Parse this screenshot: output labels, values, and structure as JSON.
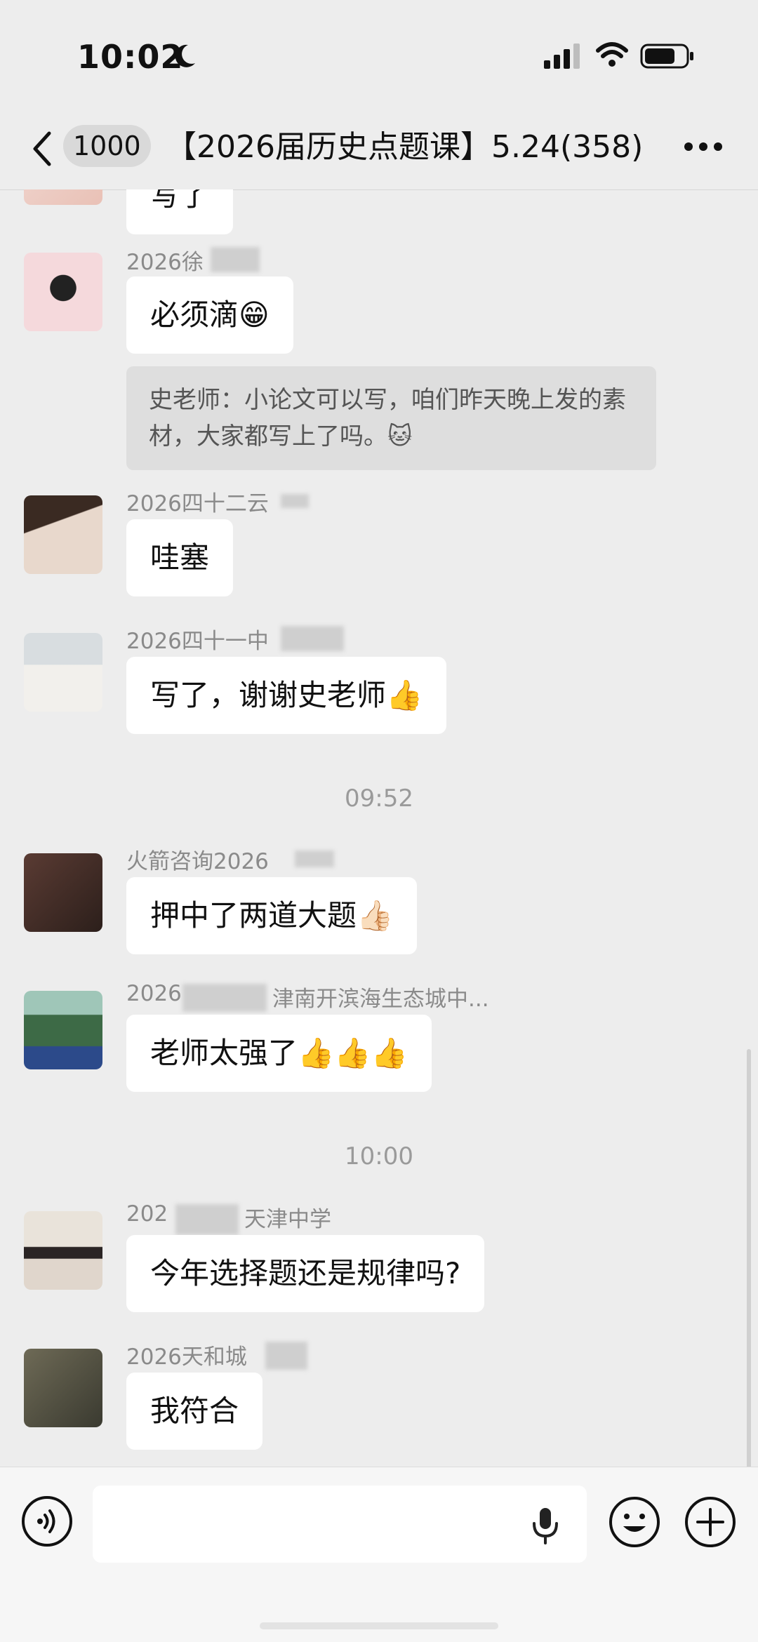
{
  "status_bar": {
    "time": "10:02"
  },
  "nav": {
    "unread_count": "1000",
    "title": "【2026届历史点题课】5.24",
    "member_count": "(358)"
  },
  "messages": [
    {
      "sender": "",
      "text": "写了"
    },
    {
      "sender": "2026徐",
      "text": "必须滴😁"
    },
    {
      "quote": "史老师：小论文可以写，咱们昨天晚上发的素材，大家都写上了吗。🐱"
    },
    {
      "sender": "2026四十二云",
      "text": "哇塞"
    },
    {
      "sender": "2026四十一中",
      "text": "写了，谢谢史老师👍"
    },
    {
      "sender": "火箭咨询2026",
      "text": "押中了两道大题👍🏻"
    },
    {
      "sender_left": "2026",
      "sender_right": "津南开滨海生态城中...",
      "text": "老师太强了👍👍👍"
    },
    {
      "sender_left": "202",
      "sender_right": "天津中学",
      "text": "今年选择题还是规律吗?"
    },
    {
      "sender": "2026天和城",
      "text": "我符合"
    }
  ],
  "timestamps": [
    "09:52",
    "10:00"
  ],
  "colors": {
    "background": "#ededed",
    "bubble": "#ffffff",
    "quote": "#dedede",
    "meta_text": "#8a8a8a"
  },
  "icons": [
    "back-icon",
    "more-icon",
    "voice-icon",
    "microphone-icon",
    "emoji-icon",
    "plus-icon"
  ]
}
